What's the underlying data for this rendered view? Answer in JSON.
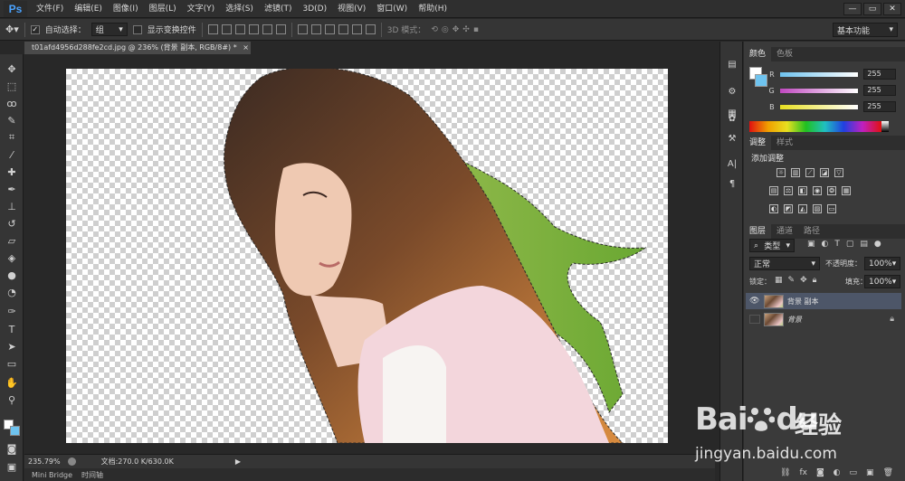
{
  "app": {
    "logo": "Ps"
  },
  "menu": [
    "文件(F)",
    "编辑(E)",
    "图像(I)",
    "图层(L)",
    "文字(Y)",
    "选择(S)",
    "滤镜(T)",
    "3D(D)",
    "视图(V)",
    "窗口(W)",
    "帮助(H)"
  ],
  "window_controls": {
    "minimize": "—",
    "restore": "▭",
    "close": "✕"
  },
  "options": {
    "auto_select_label": "自动选择：",
    "auto_select_value": "组",
    "show_transform_label": "显示变换控件",
    "mode_3d_label": "3D 模式：",
    "workspace_value": "基本功能",
    "check": "✓"
  },
  "document": {
    "tab_title": "t01afd4956d288fe2cd.jpg @ 236% (背景 副本, RGB/8#) *",
    "tab_close": "×",
    "zoom": "235.79%",
    "doc_size": "文档:270.0 K/630.0K",
    "bottom_tabs": [
      "Mini Bridge",
      "时间轴"
    ]
  },
  "color_panel": {
    "tabs": [
      "颜色",
      "色板"
    ],
    "channels": [
      {
        "label": "R",
        "value": "255"
      },
      {
        "label": "G",
        "value": "255"
      },
      {
        "label": "B",
        "value": "255"
      }
    ]
  },
  "adjust_panel": {
    "tabs": [
      "调整",
      "样式"
    ],
    "add_label": "添加调整"
  },
  "layers_panel": {
    "tabs": [
      "图层",
      "通道",
      "路径"
    ],
    "filter_value": "类型",
    "blend_mode": "正常",
    "opacity_label": "不透明度：",
    "opacity_value": "100%",
    "lock_label": "锁定：",
    "fill_label": "填充：",
    "fill_value": "100%",
    "layers": [
      {
        "name": "背景 副本",
        "selected": true,
        "visible": true
      },
      {
        "name": "背景",
        "selected": false,
        "visible": false,
        "locked": true
      }
    ],
    "footer_icons": [
      "link-icon",
      "fx-icon",
      "mask-icon",
      "adjustment-icon",
      "group-icon",
      "new-layer-icon",
      "trash-icon"
    ]
  },
  "watermark": {
    "brand": "Bai",
    "brand2": "du",
    "cn": "经验",
    "url": "jingyan.baidu.com"
  },
  "colors": {
    "accent_blue": "#4aa3ff",
    "selected_layer": "#4d5668"
  }
}
